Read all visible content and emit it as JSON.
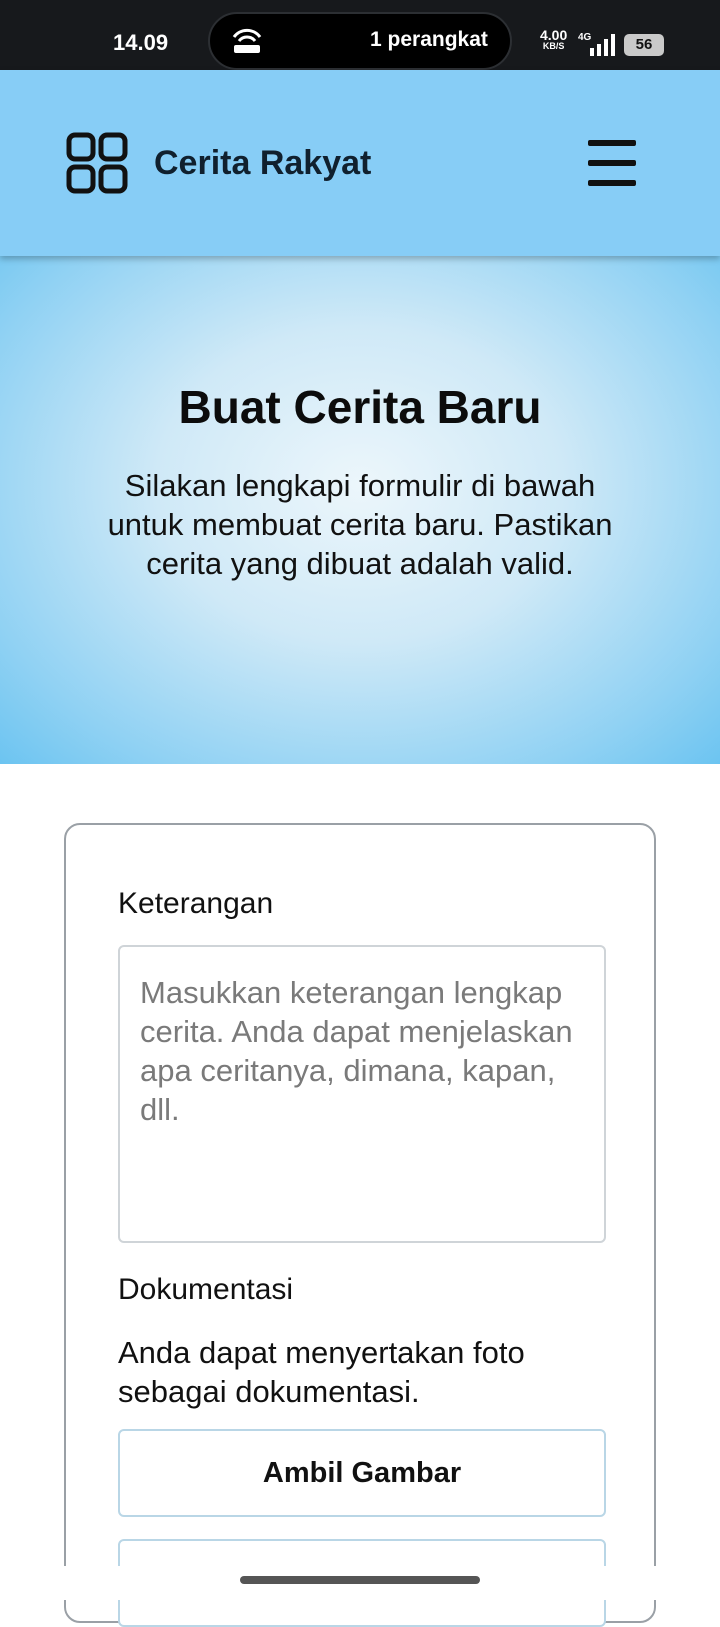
{
  "status_bar": {
    "time": "14.09",
    "pill_text": "1 perangkat",
    "net_speed": "4.00",
    "net_speed_unit": "KB/S",
    "net_type": "4G",
    "battery": "56"
  },
  "header": {
    "title": "Cerita Rakyat"
  },
  "hero": {
    "title": "Buat Cerita Baru",
    "description": "Silakan lengkapi formulir di bawah untuk membuat cerita baru. Pastikan cerita yang dibuat adalah valid."
  },
  "form": {
    "keterangan_label": "Keterangan",
    "keterangan_placeholder": "Masukkan keterangan lengkap cerita. Anda dapat menjelaskan apa ceritanya, dimana, kapan, dll.",
    "keterangan_value": "",
    "dokumentasi_label": "Dokumentasi",
    "dokumentasi_desc": "Anda dapat menyertakan foto sebagai dokumentasi.",
    "ambil_gambar_label": "Ambil Gambar"
  },
  "colors": {
    "header_bg": "#87cdf6",
    "hero_edge": "#6cc4f1",
    "status_bar_bg": "#17191c"
  }
}
